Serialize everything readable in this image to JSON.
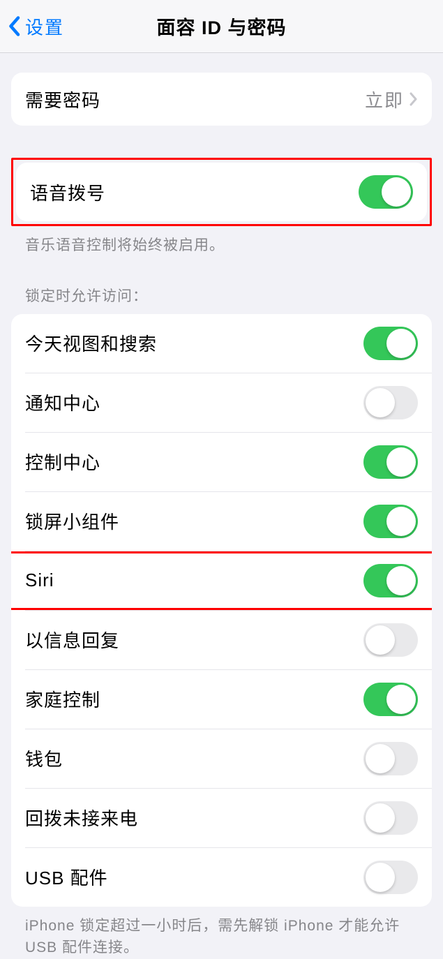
{
  "nav": {
    "back_label": "设置",
    "title": "面容 ID 与密码"
  },
  "require_passcode": {
    "label": "需要密码",
    "value": "立即"
  },
  "voice_dial": {
    "label": "语音拨号",
    "on": true,
    "footer": "音乐语音控制将始终被启用。"
  },
  "access_when_locked": {
    "header": "锁定时允许访问：",
    "items": [
      {
        "label": "今天视图和搜索",
        "on": true
      },
      {
        "label": "通知中心",
        "on": false
      },
      {
        "label": "控制中心",
        "on": true
      },
      {
        "label": "锁屏小组件",
        "on": true
      },
      {
        "label": "Siri",
        "on": true,
        "highlight": true
      },
      {
        "label": "以信息回复",
        "on": false
      },
      {
        "label": "家庭控制",
        "on": true
      },
      {
        "label": "钱包",
        "on": false
      },
      {
        "label": "回拨未接来电",
        "on": false
      },
      {
        "label": "USB 配件",
        "on": false
      }
    ],
    "footer": "iPhone 锁定超过一小时后，需先解锁 iPhone 才能允许USB 配件连接。"
  }
}
